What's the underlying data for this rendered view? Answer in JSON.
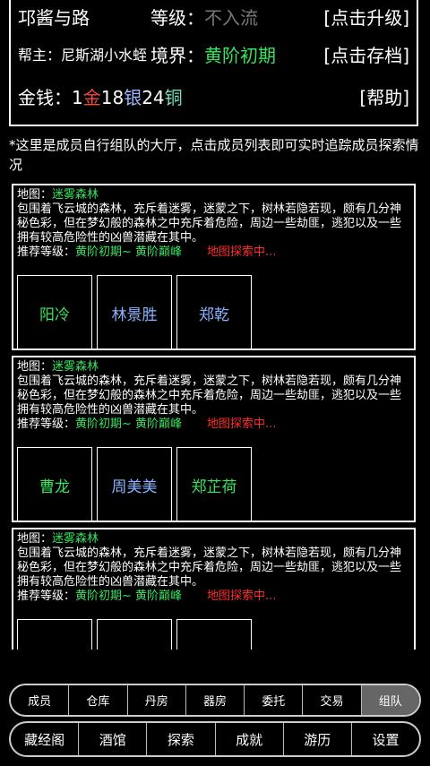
{
  "header": {
    "name": "邛酱与路",
    "level_label": "等级：",
    "level_value": "不入流",
    "upgrade": "[点击升级]",
    "leader_label": "帮主：",
    "leader_name": "尼斯湖小水蛭",
    "realm_label": "境界：",
    "realm_value": "黄阶初期",
    "save": "[点击存档]",
    "money_label": "金钱：",
    "gold_amount": "1",
    "gold_unit": "金",
    "silver_amount": "18",
    "silver_unit": "银",
    "copper_amount": "24",
    "copper_unit": "铜",
    "help": "[帮助]"
  },
  "intro": "*这里是成员自行组队的大厅，点击成员列表即可实时追踪成员探索情况",
  "cards": [
    {
      "map_label": "地图：",
      "map_name": "迷雾森林",
      "desc": "包围着飞云城的森林，充斥着迷雾，迷蒙之下，树林若隐若现，颇有几分神秘色彩，但在梦幻般的森林之中充斥着危险，周边一些劫匪，逃犯以及一些拥有较高危险性的凶兽潜藏在其中。",
      "rec_label": "推荐等级：",
      "rec_value": "黄阶初期~ 黄阶巅峰",
      "status": "地图探索中...",
      "members": [
        "阳冷",
        "林景胜",
        "郑乾"
      ]
    },
    {
      "map_label": "地图：",
      "map_name": "迷雾森林",
      "desc": "包围着飞云城的森林，充斥着迷雾，迷蒙之下，树林若隐若现，颇有几分神秘色彩，但在梦幻般的森林之中充斥着危险，周边一些劫匪，逃犯以及一些拥有较高危险性的凶兽潜藏在其中。",
      "rec_label": "推荐等级：",
      "rec_value": "黄阶初期~ 黄阶巅峰",
      "status": "地图探索中...",
      "members": [
        "曹龙",
        "周美美",
        "郑芷荷"
      ]
    },
    {
      "map_label": "地图：",
      "map_name": "迷雾森林",
      "desc": "包围着飞云城的森林，充斥着迷雾，迷蒙之下，树林若隐若现，颇有几分神秘色彩，但在梦幻般的森林之中充斥着危险，周边一些劫匪，逃犯以及一些拥有较高危险性的凶兽潜藏在其中。",
      "rec_label": "推荐等级：",
      "rec_value": "黄阶初期~ 黄阶巅峰",
      "status": "地图探索中...",
      "members": [
        "",
        "",
        ""
      ]
    }
  ],
  "nav_top": [
    "成员",
    "仓库",
    "丹房",
    "器房",
    "委托",
    "交易",
    "组队"
  ],
  "nav_bottom": [
    "藏经阁",
    "酒馆",
    "探索",
    "成就",
    "游历",
    "设置"
  ],
  "colors": {
    "accent_green": "#36e35e",
    "gold": "#f04a3d",
    "silver": "#9ab7ff",
    "copper": "#78e0b8",
    "status_red": "#ff2b2b"
  }
}
